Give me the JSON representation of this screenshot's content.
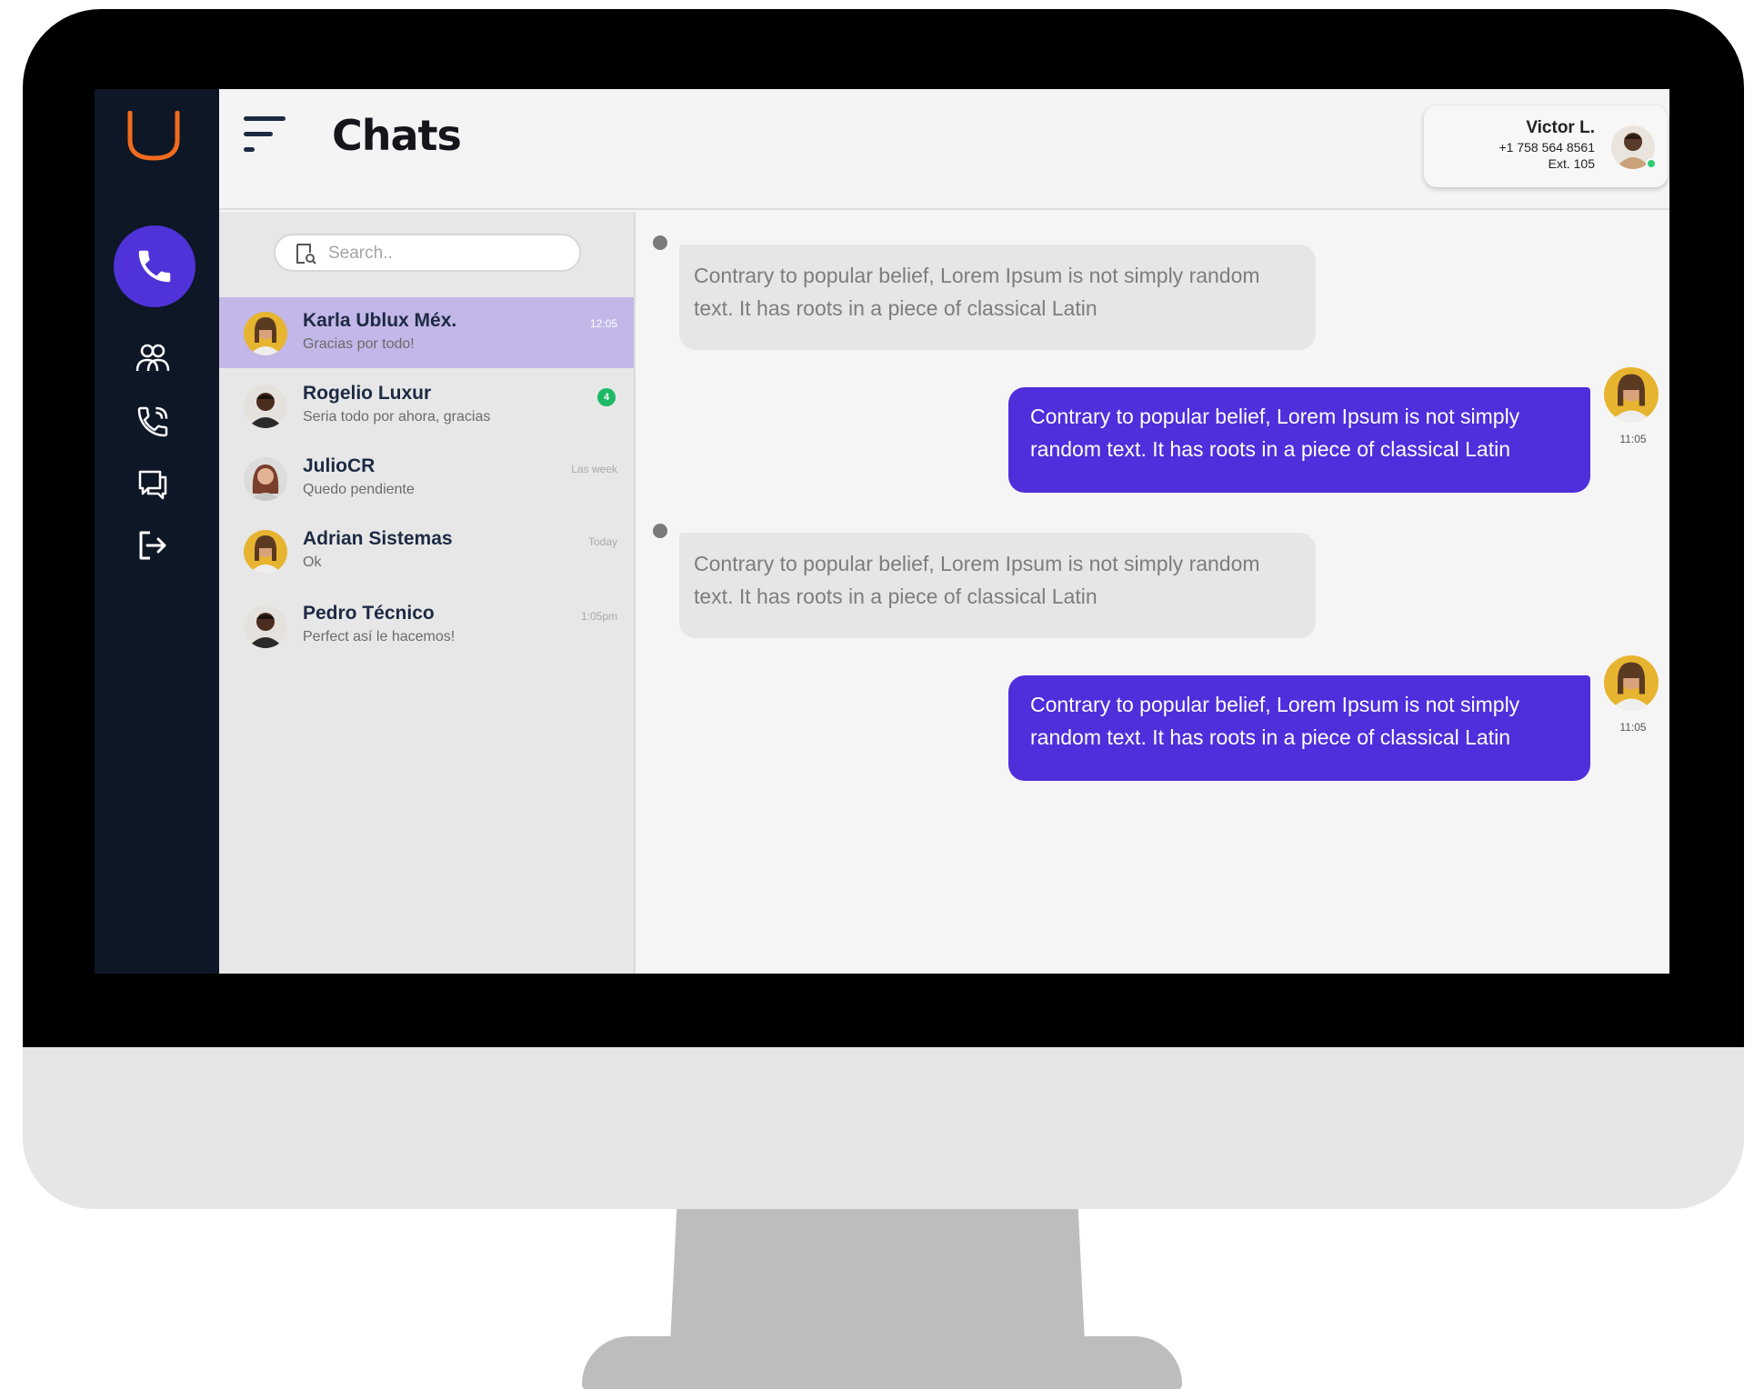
{
  "header": {
    "title": "Chats",
    "user": {
      "name": "Victor L.",
      "phone": "+1 758 564 8561",
      "ext": "Ext. 105"
    }
  },
  "nav": {
    "items": [
      {
        "icon": "phone-icon"
      },
      {
        "icon": "contacts-icon"
      },
      {
        "icon": "call-log-icon"
      },
      {
        "icon": "messages-icon"
      },
      {
        "icon": "logout-icon"
      }
    ],
    "accent": "#4f33d8",
    "logo_color": "#f26b1d"
  },
  "search": {
    "placeholder": "Search.."
  },
  "chats": [
    {
      "name": "Karla Ublux Méx.",
      "preview": "Gracias por todo!",
      "time": "12:05",
      "active": true
    },
    {
      "name": "Rogelio Luxur",
      "preview": "Seria todo por ahora, gracias",
      "unread": "4"
    },
    {
      "name": "JulioCR",
      "preview": "Quedo pendiente",
      "time": "Las week"
    },
    {
      "name": "Adrian Sistemas",
      "preview": "Ok",
      "time": "Today"
    },
    {
      "name": "Pedro Técnico",
      "preview": "Perfect así le hacemos!",
      "time": "1:05pm"
    }
  ],
  "messages": [
    {
      "direction": "in",
      "text": "Contrary to popular belief, Lorem Ipsum is not simply random text. It has roots in a piece of classical Latin"
    },
    {
      "direction": "out",
      "text": "Contrary to popular belief, Lorem Ipsum is not simply random text. It has roots in a piece of classical Latin",
      "time": "11:05"
    },
    {
      "direction": "in",
      "text": "Contrary to popular belief, Lorem Ipsum is not simply random text. It has roots in a piece of classical Latin"
    },
    {
      "direction": "out",
      "text": "Contrary to popular belief, Lorem Ipsum is not simply random text. It has roots in a piece of classical Latin",
      "time": "11:05"
    }
  ],
  "colors": {
    "active_chat": "#c2b7e8",
    "outgoing_bubble": "#4f2edc",
    "incoming_bubble": "#e6e6e6",
    "unread_badge": "#1fb965"
  }
}
